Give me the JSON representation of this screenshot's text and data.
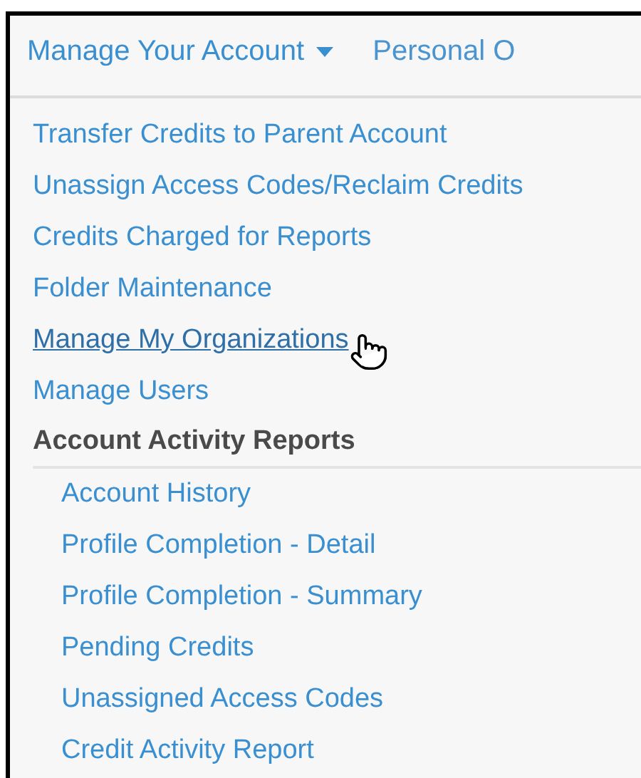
{
  "nav": {
    "tabs": [
      {
        "label": "Manage Your Account",
        "dropdown": true,
        "selected": true
      },
      {
        "label": "Personal O",
        "dropdown": false,
        "selected": false
      }
    ]
  },
  "menu": {
    "items": [
      {
        "kind": "link",
        "label": "Transfer Credits to Parent Account",
        "hovered": false
      },
      {
        "kind": "link",
        "label": "Unassign Access Codes/Reclaim Credits",
        "hovered": false
      },
      {
        "kind": "link",
        "label": "Credits Charged for Reports",
        "hovered": false
      },
      {
        "kind": "link",
        "label": "Folder Maintenance",
        "hovered": false
      },
      {
        "kind": "link",
        "label": "Manage My Organizations",
        "hovered": true
      },
      {
        "kind": "link",
        "label": "Manage Users",
        "hovered": false
      },
      {
        "kind": "heading",
        "label": "Account Activity Reports",
        "children": [
          {
            "label": "Account History",
            "hovered": false
          },
          {
            "label": "Profile Completion - Detail",
            "hovered": false
          },
          {
            "label": "Profile Completion - Summary",
            "hovered": false
          },
          {
            "label": "Pending Credits",
            "hovered": false
          },
          {
            "label": "Unassigned Access Codes",
            "hovered": false
          },
          {
            "label": "Credit Activity Report",
            "hovered": false
          }
        ]
      }
    ]
  }
}
